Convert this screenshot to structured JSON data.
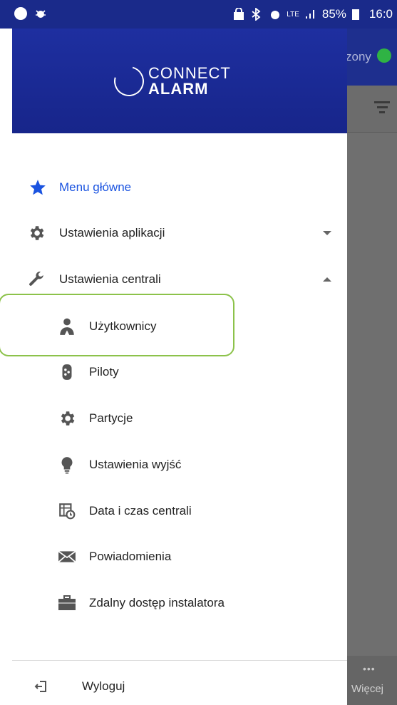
{
  "status_bar": {
    "battery": "85%",
    "time": "16:0",
    "network": "LTE"
  },
  "background_app": {
    "status_text": "zony",
    "more_dots": "•••",
    "more_label": "Więcej"
  },
  "drawer": {
    "logo": {
      "line1": "CONNECT",
      "line2": "ALARM"
    },
    "items": [
      {
        "label": "Menu główne",
        "icon": "star-icon",
        "active": true
      },
      {
        "label": "Ustawienia aplikacji",
        "icon": "gear-icon",
        "expand": "collapsed"
      },
      {
        "label": "Ustawienia centrali",
        "icon": "wrench-icon",
        "expand": "expanded"
      },
      {
        "label": "Użytkownicy",
        "icon": "user-icon"
      },
      {
        "label": "Piloty",
        "icon": "remote-icon"
      },
      {
        "label": "Partycje",
        "icon": "gear-icon"
      },
      {
        "label": "Ustawienia wyjść",
        "icon": "bulb-icon"
      },
      {
        "label": "Data i czas centrali",
        "icon": "calendar-clock-icon"
      },
      {
        "label": "Powiadomienia",
        "icon": "envelope-icon"
      },
      {
        "label": "Zdalny dostęp instalatora",
        "icon": "briefcase-icon"
      }
    ],
    "logout_label": "Wyloguj"
  },
  "colors": {
    "header_blue": "#1e2fa0",
    "active_blue": "#1a53e0",
    "highlight_green": "#8cc24a",
    "status_green": "#2fb344"
  }
}
